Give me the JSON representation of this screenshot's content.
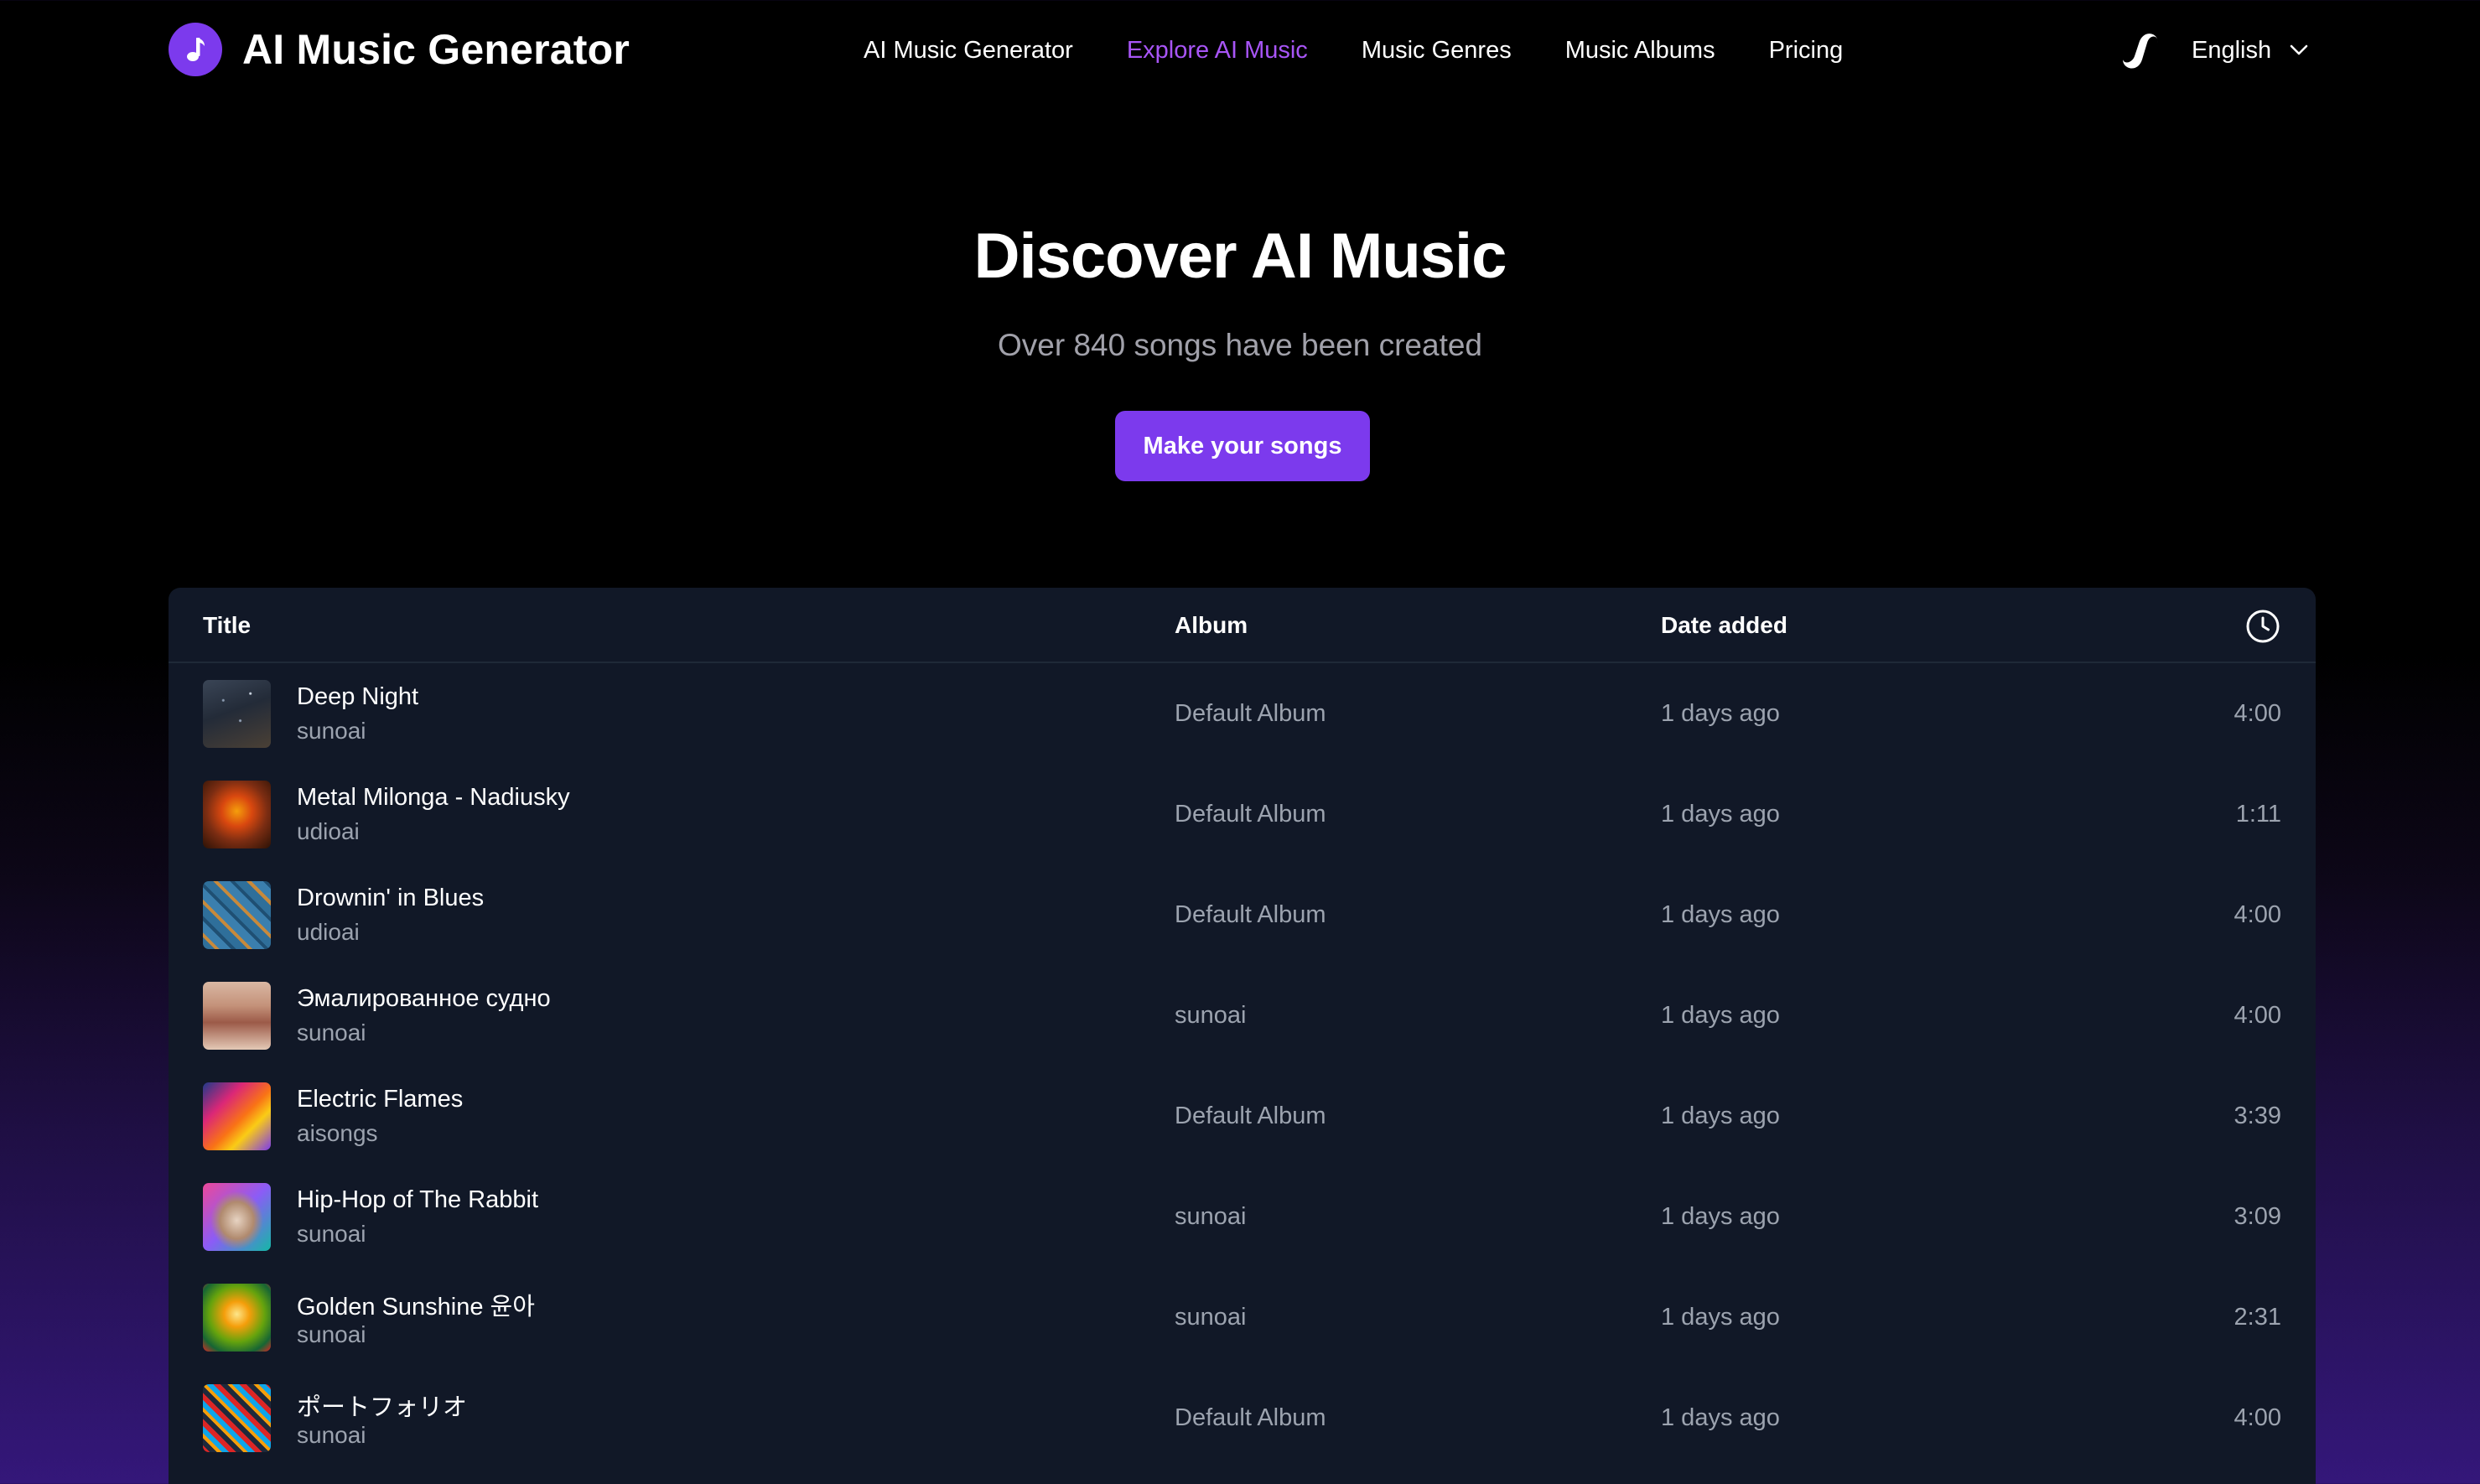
{
  "header": {
    "brand": "AI Music Generator",
    "nav": [
      {
        "label": "AI Music Generator",
        "active": false
      },
      {
        "label": "Explore AI Music",
        "active": true
      },
      {
        "label": "Music Genres",
        "active": false
      },
      {
        "label": "Music Albums",
        "active": false
      },
      {
        "label": "Pricing",
        "active": false
      }
    ],
    "language": "English"
  },
  "hero": {
    "title": "Discover AI Music",
    "subtitle": "Over 840 songs have been created",
    "cta": "Make your songs"
  },
  "table": {
    "columns": {
      "title": "Title",
      "album": "Album",
      "date": "Date added",
      "duration_icon": "clock-icon"
    },
    "rows": [
      {
        "title": "Deep Night",
        "artist": "sunoai",
        "album": "Default Album",
        "date": "1 days ago",
        "duration": "4:00"
      },
      {
        "title": "Metal Milonga - Nadiusky",
        "artist": "udioai",
        "album": "Default Album",
        "date": "1 days ago",
        "duration": "1:11"
      },
      {
        "title": "Drownin' in Blues",
        "artist": "udioai",
        "album": "Default Album",
        "date": "1 days ago",
        "duration": "4:00"
      },
      {
        "title": "Эмалированное судно",
        "artist": "sunoai",
        "album": "sunoai",
        "date": "1 days ago",
        "duration": "4:00"
      },
      {
        "title": "Electric Flames",
        "artist": "aisongs",
        "album": "Default Album",
        "date": "1 days ago",
        "duration": "3:39"
      },
      {
        "title": "Hip-Hop of The Rabbit",
        "artist": "sunoai",
        "album": "sunoai",
        "date": "1 days ago",
        "duration": "3:09"
      },
      {
        "title": "Golden Sunshine 윤아",
        "artist": "sunoai",
        "album": "sunoai",
        "date": "1 days ago",
        "duration": "2:31"
      },
      {
        "title": "ポートフォリオ",
        "artist": "sunoai",
        "album": "Default Album",
        "date": "1 days ago",
        "duration": "4:00"
      }
    ]
  },
  "colors": {
    "accent": "#7c3aed",
    "accent_text": "#a855f7",
    "panel": "#111827",
    "muted": "#9ca3af"
  }
}
